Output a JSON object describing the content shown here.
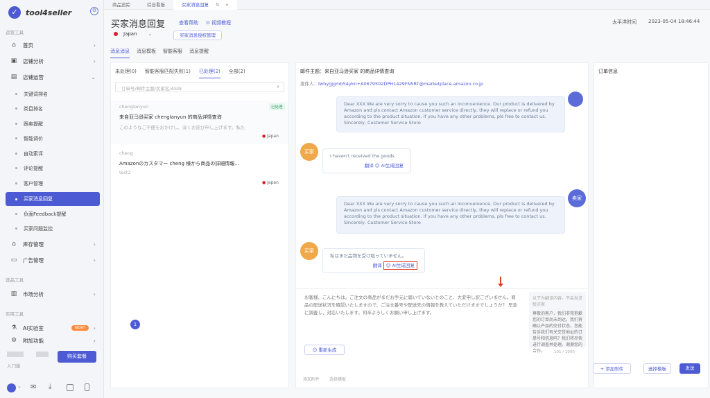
{
  "app": {
    "brand": "tool4seller"
  },
  "sidebar": {
    "section_ops": "运营工具",
    "home": "首页",
    "store_analysis": "店铺分析",
    "store_ops": "店铺运营",
    "sub_items": [
      "关键词排名",
      "类目排名",
      "跟卖提醒",
      "智能调价",
      "自动索评",
      "评论提醒",
      "客户管理",
      "买家消息回复",
      "负面Feedback提醒",
      "买家问题监控"
    ],
    "inventory": "库存管理",
    "ads": "广告管理",
    "section_product": "选品工具",
    "market": "市场分析",
    "section_practical": "实用工具",
    "ai_lab": "AI实验室",
    "ai_badge": "NEW!",
    "more_features": "附加功能",
    "entry_label": "入门版",
    "upgrade_button": "购买套餐"
  },
  "top_tabs": [
    "商品追踪",
    "综合看板",
    "买家消息回复"
  ],
  "header": {
    "title": "买家消息回复",
    "help_link": "查看帮助",
    "video_link": "视频教程",
    "marketplace": "Japan",
    "manage_button": "买家消息授权管理",
    "timezone_label": "太平洋时间",
    "datetime": "2023-05-04 18:46:44"
  },
  "page_tabs": [
    "消息消息",
    "消息模板",
    "智能客服",
    "消息提醒"
  ],
  "list": {
    "filter_tabs": [
      "未处理(0)",
      "智能客服匹配失败(1)",
      "已处理(2)",
      "全部(2)"
    ],
    "search_placeholder": "订单号/邮件主题/买家名/ASIN",
    "items": [
      {
        "sender": "chenglanyun",
        "subject": "来自亚马逊买家 chenglanyun 的商品详情查询",
        "preview": "このようなご不便をおかけし、深くお詫び申し上げます。私た",
        "country": "Japan",
        "status": "已处理"
      },
      {
        "sender": "cheng",
        "subject": "Amazonのカスタマー cheng 様から商品の詳細情報...",
        "preview": "test2",
        "country": "Japan",
        "status": ""
      }
    ],
    "page_number": "1"
  },
  "detail": {
    "subject_label": "邮件主题：",
    "subject": "来自亚马逊买家  的商品详情查询",
    "sender_label": "发件人：",
    "sender_email": "lwhygjgmb54ykn+A0679502DPH1429FN5RT@marketplace.amazon.co.jp",
    "messages": [
      {
        "from": "seller",
        "text": "Dear XXX We are very sorry to cause you such an inconvenience. Our product is delivered by Amazon and pls contact Amazon customer service directly, they will replace or refund you according to the product situation. If you have any other problems, pls free to contact us. Sincerely,              Customer Service Store"
      },
      {
        "from": "buyer",
        "avatar": "买家",
        "text": "I haven't received the goods",
        "translate": "翻译",
        "ai_reply": "AI生成回复"
      },
      {
        "from": "seller",
        "avatar": "卖家",
        "text": "Dear XXX We are very sorry to cause you such an inconvenience. Our product is delivered by Amazon and pls contact Amazon customer service directly, they will replace or refund you according to the product situation. If you have any other problems, pls free to contact us. Sincerely,              Customer Service Store"
      },
      {
        "from": "buyer",
        "avatar": "买家",
        "text": "私はまだ品物を受け取っていません。",
        "translate": "翻译",
        "ai_reply": "AI生成回复"
      }
    ],
    "reply_text": "お客様、こんにちは。ご注文の商品がまだお手元に届いていないとのこと、大変申し訳ございません。商品の配送状況を確認いたしますので、ご注文番号や配送先の情報を教えていただけますでしょうか？ 早急に調査し、対応いたします。何卒よろしくお願い申し上げます。",
    "translation_title": "以下为翻译内容，不会发送给买家",
    "translation_text": "尊敬的客户，我们非常抱歉您的订单尚未到达。我们将确认产品的交付状态，您能告诉我们有关交货地址的订单号和信息吗？我们将尽快进行调查并处理。谢谢您的合作。",
    "regen_button": "重新生成",
    "counter": "101 / 1000",
    "footer_left": [
      "添加附件",
      "选择模板"
    ],
    "attach_button": "+ 添加附件",
    "template_button": "选择模板",
    "send_button": "发送"
  },
  "order_panel": {
    "title": "订单信息"
  },
  "colors": {
    "accent": "#4c5bd4",
    "avatar_orange": "#f0a94a",
    "avatar_blue": "#5b6cd8",
    "highlight": "#e23c2e"
  }
}
